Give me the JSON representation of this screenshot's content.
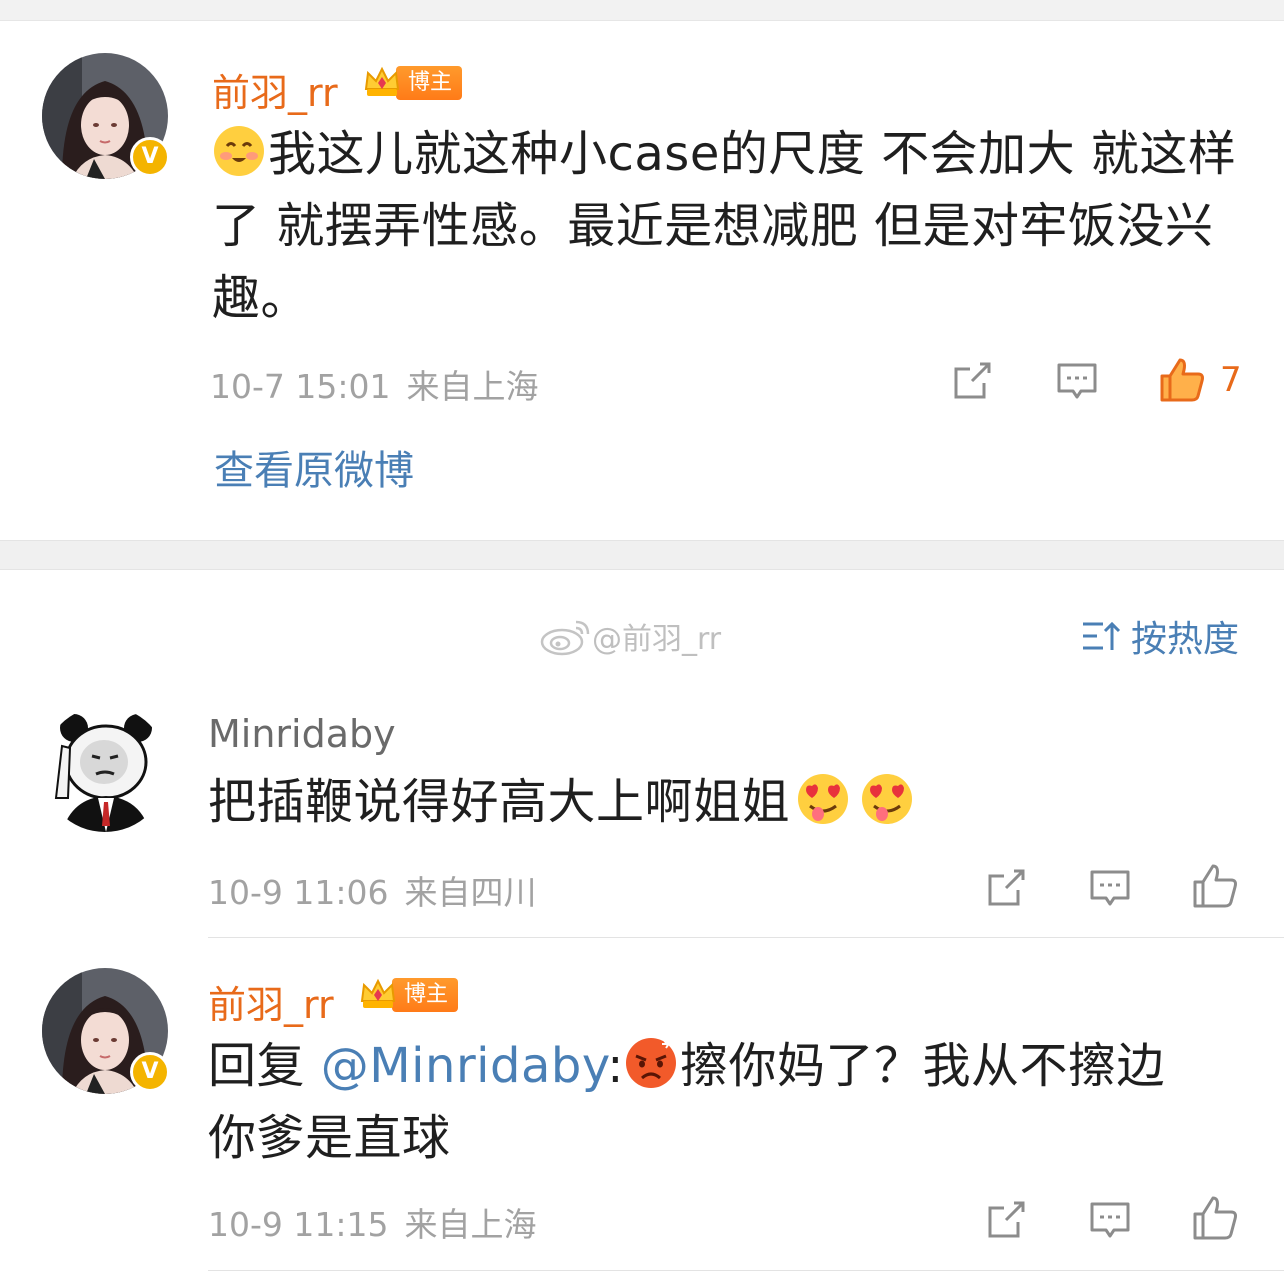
{
  "post": {
    "author": "前羽_rr",
    "badge": "博主",
    "text": "我这儿就这种小case的尺度 不会加大 就这样了 就摆弄性感。最近是想减肥 但是对牢饭没兴趣。",
    "time": "10-7 15:01",
    "location": "来自上海",
    "likes": "7",
    "view_link": "查看原微博"
  },
  "comments_header": {
    "watermark": "@前羽_rr",
    "sort_label": "按热度"
  },
  "comments": [
    {
      "author": "Minridaby",
      "text": "把插鞭说得好高大上啊姐姐",
      "time": "10-9 11:06",
      "location": "来自四川"
    },
    {
      "author": "前羽_rr",
      "badge": "博主",
      "reply_prefix": "回复 ",
      "mention": "@Minridaby",
      "colon": ":",
      "text": "擦你妈了？我从不擦边你爹是直球",
      "time": "10-9 11:15",
      "location": "来自上海"
    }
  ],
  "colors": {
    "accent_orange": "#e86a1a",
    "link_blue": "#4a7fb5",
    "meta_gray": "#a2a2a2"
  }
}
